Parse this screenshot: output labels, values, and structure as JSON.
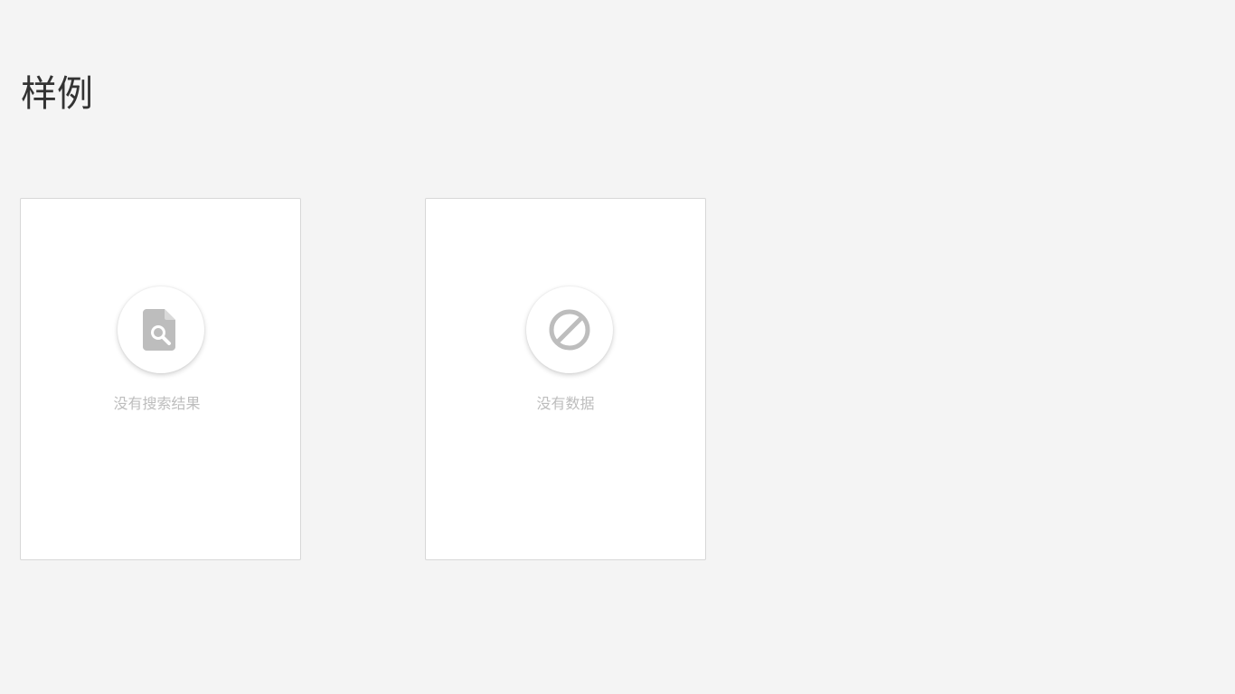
{
  "page": {
    "title": "样例"
  },
  "cards": [
    {
      "icon": "file-search-icon",
      "label": "没有搜索结果"
    },
    {
      "icon": "no-data-icon",
      "label": "没有数据"
    }
  ],
  "colors": {
    "background": "#f4f4f4",
    "card": "#ffffff",
    "card_border": "#d7d7d7",
    "icon": "#bdbdbd",
    "label": "#bdbdbd",
    "title": "#333333"
  }
}
